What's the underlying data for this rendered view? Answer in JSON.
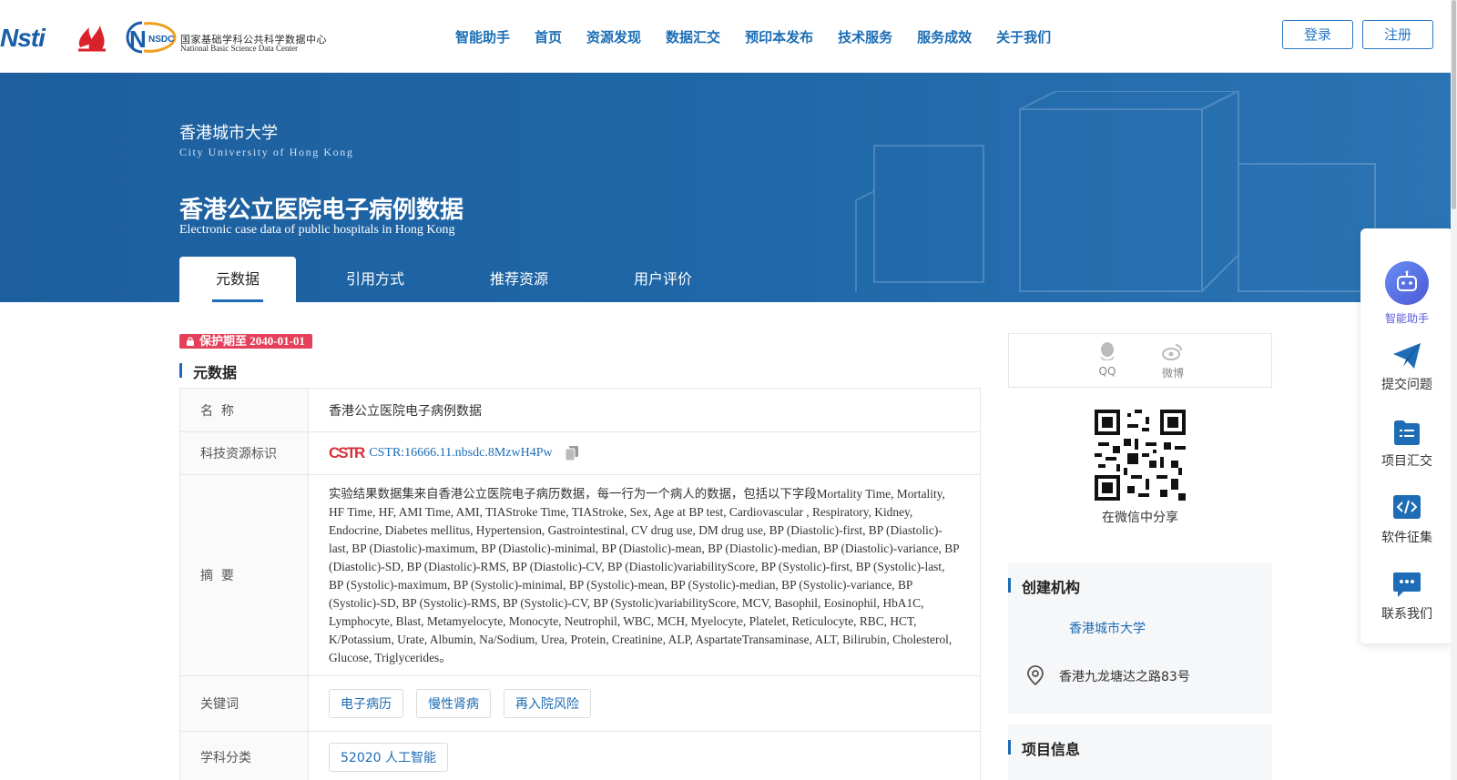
{
  "header": {
    "logos": {
      "cstr_text": "Nsti",
      "nsdc_badge": "NSDC",
      "nsdc_cn": "国家基础学科公共科学数据中心",
      "nsdc_en": "National Basic Science Data Center"
    },
    "nav": [
      "智能助手",
      "首页",
      "资源发现",
      "数据汇交",
      "预印本发布",
      "技术服务",
      "服务成效",
      "关于我们"
    ],
    "login_label": "登录",
    "register_label": "注册"
  },
  "banner": {
    "org_cn": "香港城市大学",
    "org_en": "City University of Hong Kong",
    "title": "香港公立医院电子病例数据",
    "subtitle": "Electronic case data of public hospitals in Hong Kong",
    "tabs": [
      "元数据",
      "引用方式",
      "推荐资源",
      "用户评价"
    ],
    "active_tab": "元数据"
  },
  "protection": {
    "label": "保护期至 2040-01-01"
  },
  "metadata": {
    "section_title": "元数据",
    "rows": {
      "name_label": "名  称",
      "name_value": "香港公立医院电子病例数据",
      "id_label": "科技资源标识",
      "id_logo": "CSTR",
      "id_value": "CSTR:16666.11.nbsdc.8MzwH4Pw",
      "abstract_label": "摘  要",
      "abstract_value": "实验结果数据集来自香港公立医院电子病历数据，每一行为一个病人的数据，包括以下字段Mortality Time, Mortality, HF Time, HF, AMI Time, AMI, TIAStroke Time, TIAStroke, Sex, Age at BP test, Cardiovascular , Respiratory, Kidney, Endocrine, Diabetes mellitus, Hypertension, Gastrointestinal, CV drug use, DM drug use, BP (Diastolic)-first, BP (Diastolic)-last, BP (Diastolic)-maximum, BP (Diastolic)-minimal, BP (Diastolic)-mean, BP (Diastolic)-median, BP (Diastolic)-variance, BP (Diastolic)-SD, BP (Diastolic)-RMS, BP (Diastolic)-CV, BP (Diastolic)variabilityScore, BP (Systolic)-first, BP (Systolic)-last, BP (Systolic)-maximum, BP (Systolic)-minimal, BP (Systolic)-mean, BP (Systolic)-median, BP (Systolic)-variance, BP (Systolic)-SD, BP (Systolic)-RMS, BP (Systolic)-CV, BP (Systolic)variabilityScore, MCV, Basophil, Eosinophil, HbA1C, Lymphocyte, Blast, Metamyelocyte, Monocyte, Neutrophil, WBC, MCH, Myelocyte, Platelet, Reticulocyte, RBC, HCT, K/Potassium, Urate, Albumin, Na/Sodium, Urea, Protein, Creatinine, ALP, AspartateTransaminase, ALT, Bilirubin, Cholesterol, Glucose, Triglycerides。",
      "keywords_label": "关键词",
      "keywords": [
        "电子病历",
        "慢性肾病",
        "再入院风险"
      ],
      "subject_label": "学科分类",
      "subject_value": "52020 人工智能"
    }
  },
  "share": {
    "qq_label": "QQ",
    "weibo_label": "微博",
    "wechat_caption": "在微信中分享"
  },
  "creator": {
    "section_title": "创建机构",
    "name": "香港城市大学",
    "address": "香港九龙塘达之路83号"
  },
  "project": {
    "section_title": "项目信息"
  },
  "side_panel": {
    "ai_label": "智能助手",
    "items": [
      "提交问题",
      "项目汇交",
      "软件征集",
      "联系我们"
    ]
  },
  "colors": {
    "primary": "#1d6cb5",
    "banner": "#1f67a8",
    "badge": "#e4405a"
  }
}
